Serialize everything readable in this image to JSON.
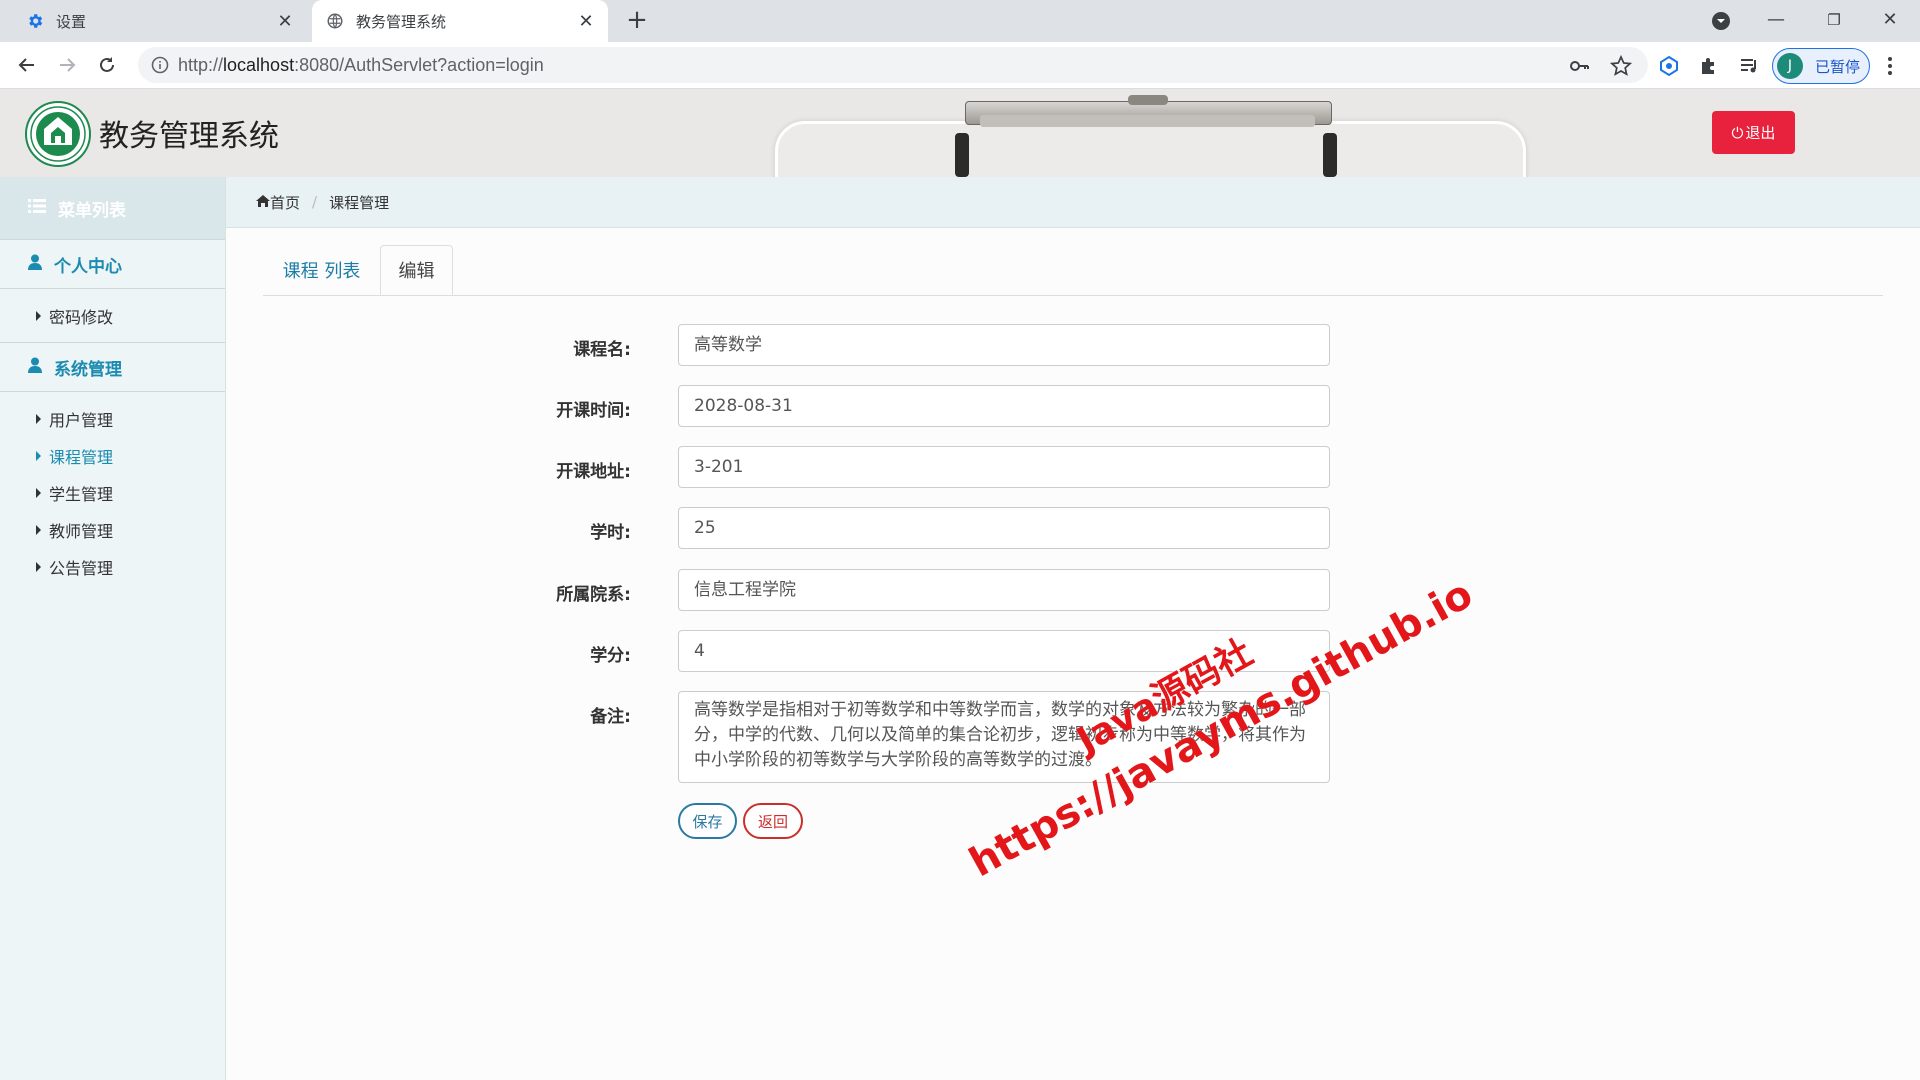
{
  "browser": {
    "tabs": [
      {
        "title": "设置",
        "icon": "settings-gear-icon",
        "active": false
      },
      {
        "title": "教务管理系统",
        "icon": "globe-icon",
        "active": true
      }
    ],
    "url_prefix": "http://",
    "url_host": "localhost",
    "url_rest": ":8080/AuthServlet?action=login",
    "profile_initial": "J",
    "profile_label": "已暂停"
  },
  "header": {
    "site_title": "教务管理系统",
    "logout_label": "退出"
  },
  "sidebar": {
    "heading": "菜单列表",
    "groups": [
      {
        "label": "个人中心",
        "items": [
          {
            "label": "密码修改"
          }
        ]
      },
      {
        "label": "系统管理",
        "items": [
          {
            "label": "用户管理"
          },
          {
            "label": "课程管理",
            "active": true
          },
          {
            "label": "学生管理"
          },
          {
            "label": "教师管理"
          },
          {
            "label": "公告管理"
          }
        ]
      }
    ]
  },
  "breadcrumb": {
    "home": "首页",
    "current": "课程管理"
  },
  "tabs": [
    {
      "label": "课程 列表"
    },
    {
      "label": "编辑",
      "active": true
    }
  ],
  "form": {
    "name": {
      "label": "课程名:",
      "value": "高等数学"
    },
    "date": {
      "label": "开课时间:",
      "value": "2028-08-31"
    },
    "place": {
      "label": "开课地址:",
      "value": "3-201"
    },
    "hours": {
      "label": "学时:",
      "value": "25"
    },
    "dept": {
      "label": "所属院系:",
      "value": "信息工程学院"
    },
    "credit": {
      "label": "学分:",
      "value": "4"
    },
    "remark": {
      "label": "备注:",
      "value": "高等数学是指相对于初等数学和中等数学而言，数学的对象及方法较为繁杂的一部分，中学的代数、几何以及简单的集合论初步，逻辑初步称为中等数学，将其作为中小学阶段的初等数学与大学阶段的高等数学的过渡。"
    },
    "save_label": "保存",
    "back_label": "返回"
  },
  "watermark": {
    "line1": "Java源码社",
    "line2": "https://javayms.github.io"
  },
  "colors": {
    "accent": "#1b8bb0",
    "logout": "#e8213d",
    "watermark": "#e3161a"
  }
}
